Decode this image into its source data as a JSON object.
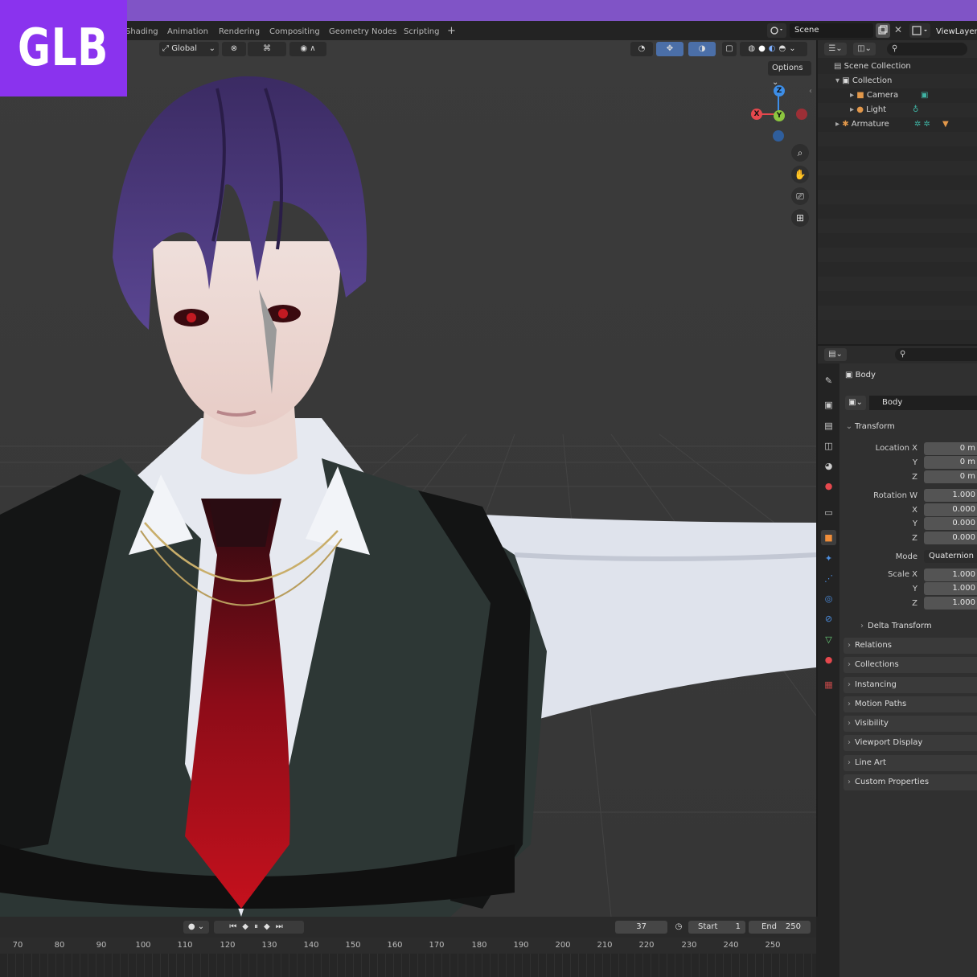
{
  "badge": "GLB",
  "workspace_tabs": [
    "Shading",
    "Animation",
    "Rendering",
    "Compositing",
    "Geometry Nodes",
    "Scripting"
  ],
  "add_tab_glyph": "+",
  "scene_name": "Scene",
  "view_layer_name": "ViewLayer",
  "viewport": {
    "orientation": "Global",
    "options_label": "Options",
    "gizmo": {
      "x": "X",
      "y": "Y",
      "z": "Z"
    },
    "shading_mode": "material-preview"
  },
  "timeline": {
    "current_frame": "37",
    "start_label": "Start",
    "start_frame": "1",
    "end_label": "End",
    "end_frame": "250",
    "ruler": [
      "70",
      "80",
      "90",
      "100",
      "110",
      "120",
      "130",
      "140",
      "150",
      "160",
      "170",
      "180",
      "190",
      "200",
      "210",
      "220",
      "230",
      "240",
      "250"
    ]
  },
  "outliner": {
    "root": "Scene Collection",
    "collection": "Collection",
    "items": [
      "Camera",
      "Light",
      "Armature"
    ]
  },
  "properties": {
    "object_name": "Body",
    "datablock": "Body",
    "transform_panel": "Transform",
    "location": {
      "label": "Location X",
      "y": "Y",
      "z": "Z",
      "x_val": "0 m",
      "y_val": "0 m",
      "z_val": "0 m"
    },
    "rotation": {
      "label": "Rotation W",
      "x": "X",
      "y": "Y",
      "z": "Z",
      "w_val": "1.000",
      "x_val": "0.000",
      "y_val": "0.000",
      "z_val": "0.000"
    },
    "mode": {
      "label": "Mode",
      "value": "Quaternion (W"
    },
    "scale": {
      "label": "Scale X",
      "y": "Y",
      "z": "Z",
      "x_val": "1.000",
      "y_val": "1.000",
      "z_val": "1.000"
    },
    "delta_transform": "Delta Transform",
    "panels": [
      "Relations",
      "Collections",
      "Instancing",
      "Motion Paths",
      "Visibility",
      "Viewport Display",
      "Line Art",
      "Custom Properties"
    ]
  },
  "colors": {
    "accent_purple": "#8054c6",
    "badge_purple": "#8a33ee",
    "axis_x": "#e5484d",
    "axis_y": "#8cc63f",
    "axis_z": "#3d8ee8",
    "active_tab": "#f08e3a"
  }
}
